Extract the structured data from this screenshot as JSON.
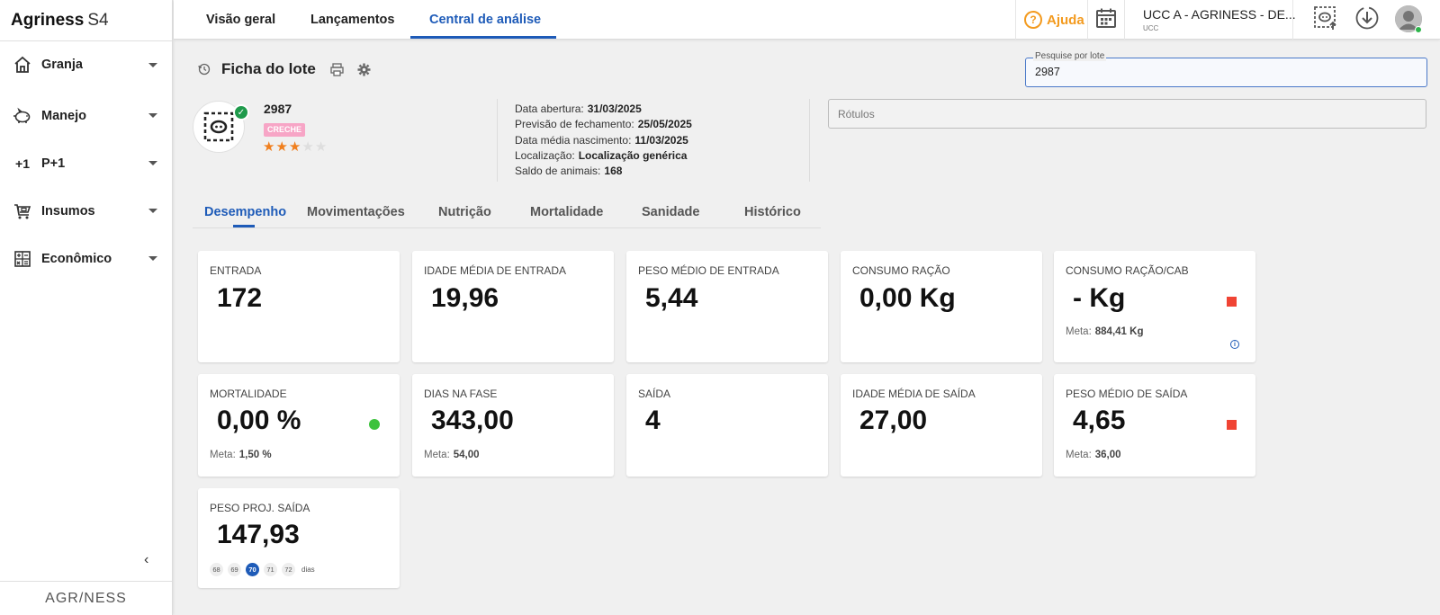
{
  "brand": {
    "name": "Agriness",
    "suffix": "S4"
  },
  "sidebar": {
    "items": [
      {
        "label": "Granja",
        "icon": "home-icon"
      },
      {
        "label": "Manejo",
        "icon": "pig-icon"
      },
      {
        "label": "P+1",
        "icon": "plus-one-icon"
      },
      {
        "label": "Insumos",
        "icon": "cart-icon"
      },
      {
        "label": "Econômico",
        "icon": "calculator-icon"
      }
    ],
    "collapse": "‹",
    "footer": "AGR/NESS"
  },
  "topnav": {
    "tabs": [
      "Visão geral",
      "Lançamentos",
      "Central de análise"
    ],
    "active_tab": "Central de análise",
    "help_label": "Ajuda",
    "farm_name": "UCC A - AGRINESS - DE...",
    "farm_sub": "UCC"
  },
  "header": {
    "title": "Ficha do lote",
    "search_legend": "Pesquise por lote",
    "search_value": "2987"
  },
  "lote": {
    "number": "2987",
    "phase": "CRECHE",
    "rating": 3,
    "rating_max": 5
  },
  "info": {
    "abertura_label": "Data abertura:",
    "abertura_value": "31/03/2025",
    "fechamento_label": "Previsão de fechamento:",
    "fechamento_value": "25/05/2025",
    "nascimento_label": "Data média nascimento:",
    "nascimento_value": "11/03/2025",
    "localizacao_label": "Localização:",
    "localizacao_value": "Localização genérica",
    "saldo_label": "Saldo de animais:",
    "saldo_value": "168"
  },
  "rotulos_placeholder": "Rótulos",
  "subtabs": [
    "Desempenho",
    "Movimentações",
    "Nutrição",
    "Mortalidade",
    "Sanidade",
    "Histórico"
  ],
  "active_subtab": "Desempenho",
  "cards": {
    "entrada": {
      "title": "ENTRADA",
      "value": "172"
    },
    "idade_entrada": {
      "title": "IDADE MÉDIA DE ENTRADA",
      "value": "19,96"
    },
    "peso_entrada": {
      "title": "PESO MÉDIO DE ENTRADA",
      "value": "5,44"
    },
    "consumo_racao": {
      "title": "CONSUMO RAÇÃO",
      "value": "0,00 Kg"
    },
    "consumo_cab": {
      "title": "CONSUMO RAÇÃO/CAB",
      "value": "- Kg",
      "meta_label": "Meta:",
      "meta_value": "884,41 Kg",
      "status": "bad"
    },
    "mortalidade": {
      "title": "MORTALIDADE",
      "value": "0,00 %",
      "meta_label": "Meta:",
      "meta_value": "1,50 %",
      "status": "good"
    },
    "dias_fase": {
      "title": "DIAS NA FASE",
      "value": "343,00",
      "meta_label": "Meta:",
      "meta_value": "54,00"
    },
    "saida": {
      "title": "SAÍDA",
      "value": "4"
    },
    "idade_saida": {
      "title": "IDADE MÉDIA DE SAÍDA",
      "value": "27,00"
    },
    "peso_saida": {
      "title": "PESO MÉDIO DE SAÍDA",
      "value": "4,65",
      "meta_label": "Meta:",
      "meta_value": "36,00",
      "status": "bad"
    },
    "peso_proj": {
      "title": "PESO PROJ. SAÍDA",
      "value": "147,93",
      "days": [
        "68",
        "69",
        "70",
        "71",
        "72"
      ],
      "selected_day": "70",
      "days_label": "dias"
    }
  },
  "colors": {
    "accent": "#1e5bb8",
    "help": "#f39a1e",
    "bad": "#f04434",
    "good": "#3cc23c",
    "phase": "#f7a5c6",
    "star": "#f07f1e"
  }
}
